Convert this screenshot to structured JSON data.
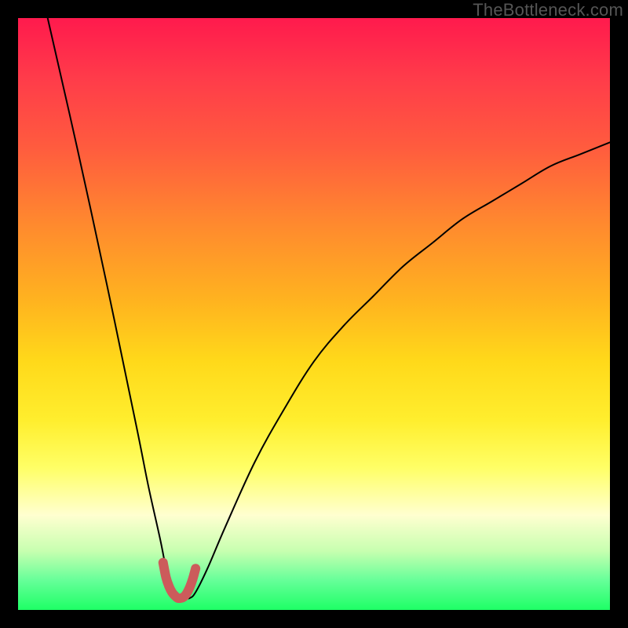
{
  "watermark": "TheBottleneck.com",
  "chart_data": {
    "type": "line",
    "title": "",
    "xlabel": "",
    "ylabel": "",
    "xlim": [
      0,
      100
    ],
    "ylim": [
      0,
      100
    ],
    "series": [
      {
        "name": "bottleneck-curve",
        "x": [
          5,
          10,
          15,
          20,
          22,
          24,
          25,
          26,
          27,
          28,
          29,
          30,
          32,
          35,
          40,
          45,
          50,
          55,
          60,
          65,
          70,
          75,
          80,
          85,
          90,
          95,
          100
        ],
        "values": [
          100,
          78,
          55,
          31,
          21,
          12,
          7,
          3,
          2,
          2,
          2,
          3,
          7,
          14,
          25,
          34,
          42,
          48,
          53,
          58,
          62,
          66,
          69,
          72,
          75,
          77,
          79
        ],
        "color": "#000000",
        "line_width": 2
      },
      {
        "name": "bottleneck-minimum-highlight",
        "x": [
          24.5,
          25,
          25.5,
          26,
          26.5,
          27,
          27.5,
          28,
          28.5,
          29,
          29.5,
          30
        ],
        "values": [
          8,
          5.5,
          4,
          3,
          2.4,
          2,
          2,
          2.2,
          2.8,
          3.8,
          5.2,
          7
        ],
        "color": "#cc5b5b",
        "line_width": 12
      }
    ],
    "gradient_stops": [
      {
        "pos": 0,
        "color": "#ff1a4d"
      },
      {
        "pos": 22,
        "color": "#ff5c3e"
      },
      {
        "pos": 48,
        "color": "#ffd91a"
      },
      {
        "pos": 76,
        "color": "#ffff66"
      },
      {
        "pos": 90,
        "color": "#c8ffb0"
      },
      {
        "pos": 100,
        "color": "#1eff66"
      }
    ]
  }
}
